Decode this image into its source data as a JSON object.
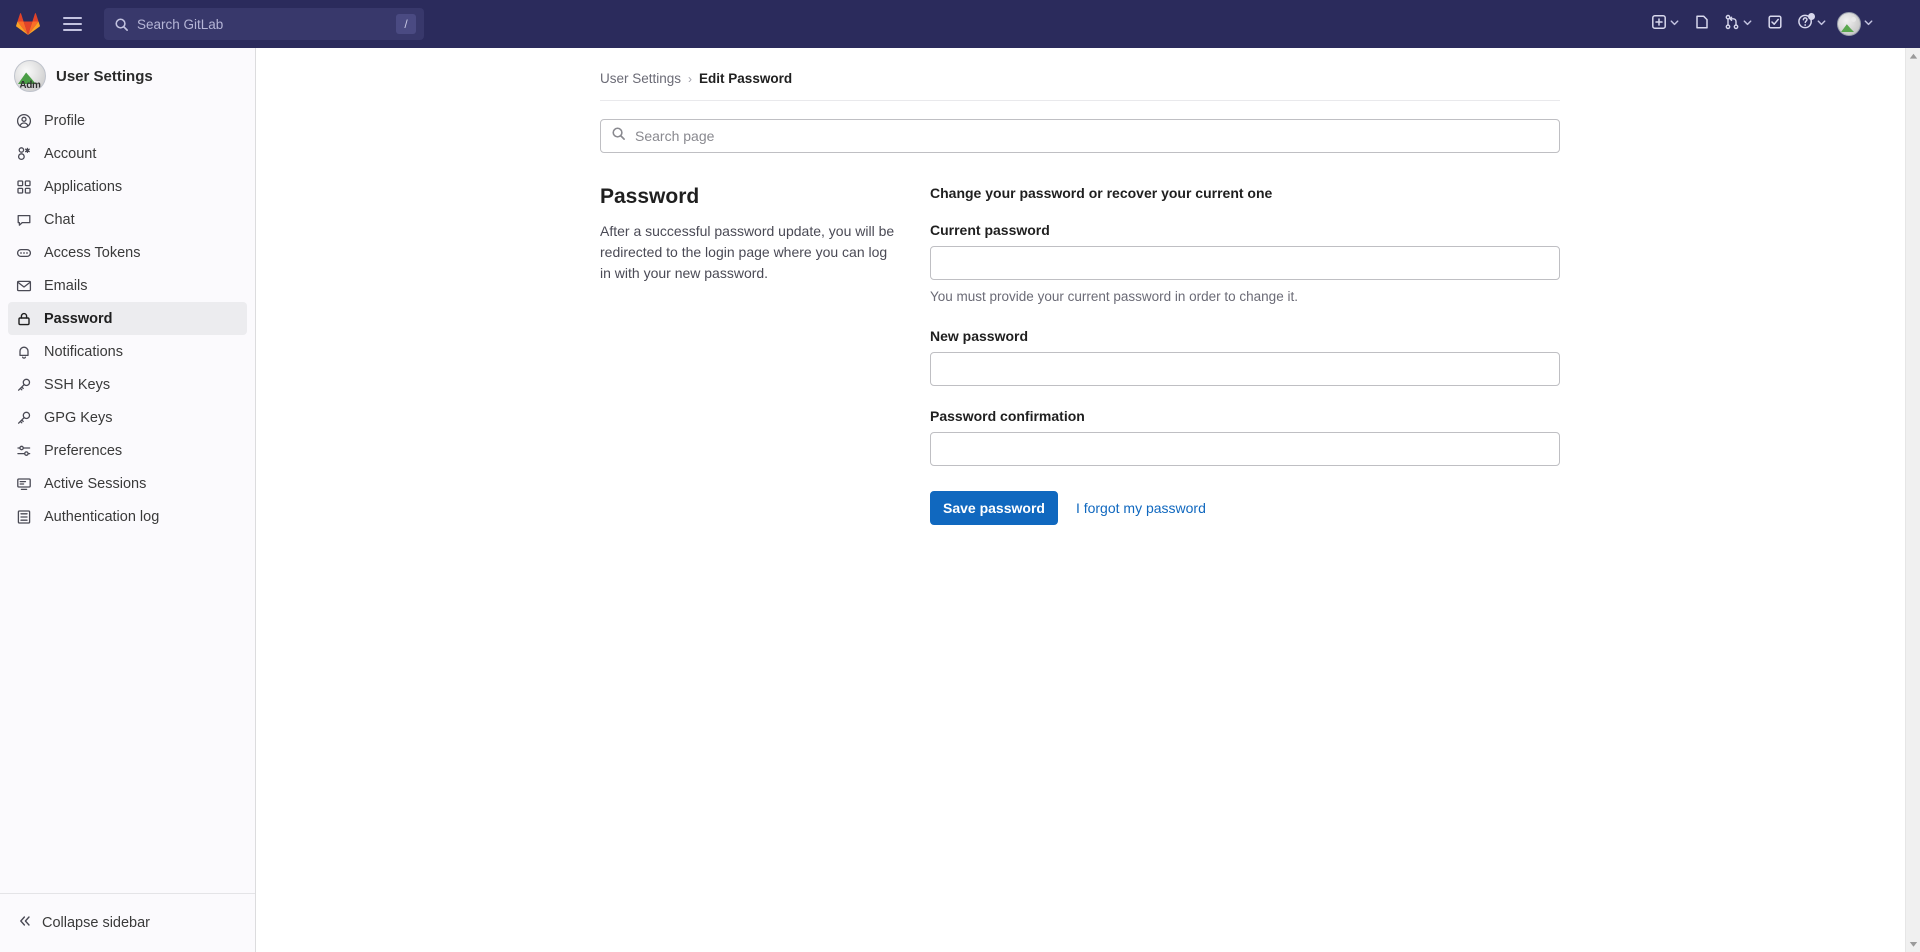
{
  "navbar": {
    "logo_icon": "gitlab-logo-icon",
    "menu_icon": "hamburger-menu-icon",
    "search": {
      "placeholder": "Search GitLab",
      "value": "",
      "shortcut_key": "/",
      "icon": "search-icon"
    },
    "actions": [
      {
        "name": "create-new-menu",
        "icon": "plus-square-icon",
        "has_caret": true
      },
      {
        "name": "issues-link",
        "icon": "issues-icon",
        "has_caret": false
      },
      {
        "name": "merge-requests-menu",
        "icon": "merge-request-icon",
        "has_caret": true
      },
      {
        "name": "todos-link",
        "icon": "todo-checkbox-icon",
        "has_caret": false
      },
      {
        "name": "help-menu",
        "icon": "question-circle-icon",
        "has_caret": true,
        "has_notification_dot": true
      },
      {
        "name": "user-menu",
        "icon": "user-avatar-icon",
        "has_caret": true
      }
    ]
  },
  "sidebar": {
    "context_title": "User Settings",
    "avatar_label": "Adm",
    "items": [
      {
        "label": "Profile",
        "icon": "user-circle-icon",
        "active": false
      },
      {
        "label": "Account",
        "icon": "account-icon",
        "active": false
      },
      {
        "label": "Applications",
        "icon": "applications-grid-icon",
        "active": false
      },
      {
        "label": "Chat",
        "icon": "comment-icon",
        "active": false
      },
      {
        "label": "Access Tokens",
        "icon": "token-icon",
        "active": false
      },
      {
        "label": "Emails",
        "icon": "envelope-icon",
        "active": false
      },
      {
        "label": "Password",
        "icon": "lock-icon",
        "active": true
      },
      {
        "label": "Notifications",
        "icon": "bell-icon",
        "active": false
      },
      {
        "label": "SSH Keys",
        "icon": "key-icon",
        "active": false
      },
      {
        "label": "GPG Keys",
        "icon": "key-icon",
        "active": false
      },
      {
        "label": "Preferences",
        "icon": "sliders-icon",
        "active": false
      },
      {
        "label": "Active Sessions",
        "icon": "monitor-icon",
        "active": false
      },
      {
        "label": "Authentication log",
        "icon": "log-list-icon",
        "active": false
      }
    ],
    "collapse_label": "Collapse sidebar",
    "collapse_icon": "chevron-double-left-icon"
  },
  "breadcrumb": {
    "root": "User Settings",
    "separator": "›",
    "current": "Edit Password"
  },
  "page_search": {
    "placeholder": "Search page",
    "value": "",
    "icon": "search-icon"
  },
  "password_section": {
    "heading": "Password",
    "description": "After a successful password update, you will be redirected to the login page where you can log in with your new password.",
    "form_heading": "Change your password or recover your current one",
    "fields": [
      {
        "label": "Current password",
        "value": "",
        "help": "You must provide your current password in order to change it.",
        "name": "current-password-field"
      },
      {
        "label": "New password",
        "value": "",
        "help": "",
        "name": "new-password-field"
      },
      {
        "label": "Password confirmation",
        "value": "",
        "help": "",
        "name": "password-confirmation-field"
      }
    ],
    "submit_label": "Save password",
    "forgot_link_label": "I forgot my password"
  },
  "colors": {
    "navbar_bg": "#2b2b5c",
    "primary_button": "#1068bf",
    "link": "#1068bf",
    "sidebar_bg": "#fbfafd",
    "active_item_bg": "#ececef"
  }
}
